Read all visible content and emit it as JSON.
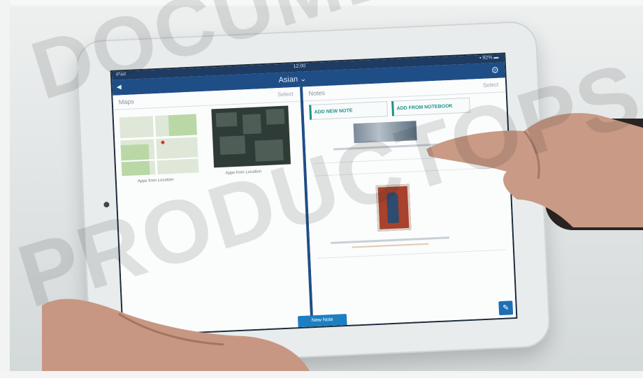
{
  "watermark": {
    "line1": "DOCUMENTS",
    "line2": "PRODUCTOPS"
  },
  "status_bar": {
    "carrier": "iPad ",
    "time": "12:00",
    "battery": "▪ 92% ▬"
  },
  "nav_bar": {
    "back_label": "◀ ",
    "title": "Asian ⌄",
    "gear_icon": "gear-icon"
  },
  "maps_pane": {
    "title": "Maps",
    "select_label": "Select",
    "items": [
      {
        "caption": "Apps from Location"
      },
      {
        "caption": "Apps from Location"
      }
    ]
  },
  "notes_pane": {
    "title": "Notes",
    "select_label": "Select",
    "add_new_note": "ADD NEW NOTE",
    "add_from_notebook": "ADD FROM NOTEBOOK"
  },
  "toolbar": {
    "new_note_label": "New Note",
    "edit_icon": "pencil-icon"
  },
  "colors": {
    "nav_blue": "#1f4e86",
    "accent_teal": "#1f8f8a",
    "button_blue": "#1d7fc1"
  }
}
